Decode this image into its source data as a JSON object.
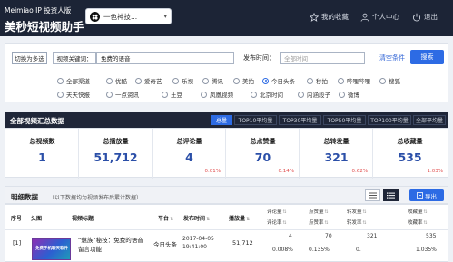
{
  "header": {
    "brand_line1": "Meimiao IP 投资人版",
    "brand_line2": "美秒短视频助手",
    "app_selector": "一色神技...",
    "favorites": "我的收藏",
    "user_center": "个人中心",
    "logout": "退出"
  },
  "filter": {
    "toggle_label": "切换为多选",
    "keyword_label": "视频关键词：",
    "keyword_value": "免费的语音",
    "time_label": "发布时间：",
    "time_placeholder": "全部时间",
    "clear_label": "清空条件",
    "search_label": "搜索",
    "platforms_row1": [
      {
        "label": "全部渠道",
        "selected": false
      },
      {
        "label": "优酷",
        "selected": false
      },
      {
        "label": "爱奇艺",
        "selected": false
      },
      {
        "label": "乐视",
        "selected": false
      },
      {
        "label": "腾讯",
        "selected": false
      },
      {
        "label": "美拍",
        "selected": false
      },
      {
        "label": "今日头条",
        "selected": true
      },
      {
        "label": "秒拍",
        "selected": false
      },
      {
        "label": "哔哩哔哩",
        "selected": false
      },
      {
        "label": "搜狐",
        "selected": false
      }
    ],
    "platforms_row2": [
      {
        "label": "天天快报",
        "selected": false
      },
      {
        "label": "一点资讯",
        "selected": false
      },
      {
        "label": "土豆",
        "selected": false
      },
      {
        "label": "凤凰视频",
        "selected": false
      },
      {
        "label": "北京时间",
        "selected": false
      },
      {
        "label": "内涵段子",
        "selected": false
      },
      {
        "label": "微博",
        "selected": false
      }
    ]
  },
  "summary": {
    "title": "全部视频汇总数据",
    "tabs": [
      {
        "label": "总量",
        "active": true
      },
      {
        "label": "TOP10平均量",
        "active": false
      },
      {
        "label": "TOP30平均量",
        "active": false
      },
      {
        "label": "TOP50平均量",
        "active": false
      },
      {
        "label": "TOP100平均量",
        "active": false
      },
      {
        "label": "全部平均量",
        "active": false
      }
    ],
    "cards": [
      {
        "label": "总视频数",
        "value": "1",
        "pct": ""
      },
      {
        "label": "总播放量",
        "value": "51,712",
        "pct": ""
      },
      {
        "label": "总评论量",
        "value": "4",
        "pct": "0.01%"
      },
      {
        "label": "总点赞量",
        "value": "70",
        "pct": "0.14%"
      },
      {
        "label": "总转发量",
        "value": "321",
        "pct": "0.62%"
      },
      {
        "label": "总收藏量",
        "value": "535",
        "pct": "1.03%"
      }
    ]
  },
  "detail": {
    "title": "明细数据",
    "note": "（以下数据均为视频发布后累计数据）",
    "export_label": "导出",
    "columns": {
      "index": "序号",
      "thumb": "头图",
      "title": "视频标题",
      "platform": "平台",
      "publish_time": "发布时间",
      "plays": "播放量",
      "comments": "评论量",
      "comment_rate": "评论率",
      "likes": "点赞量",
      "like_rate": "点赞率",
      "shares": "转发量",
      "share_rate": "转发率",
      "favorites": "收藏量",
      "favorite_rate": "收藏率"
    },
    "rows": [
      {
        "index": "[1]",
        "thumb_text": "免费手机聊天软件",
        "title_line1": "“魅族”秘技：免费的语音",
        "title_line2": "留言功能！",
        "platform": "今日头条",
        "date": "2017-04-05",
        "time": "19:41:00",
        "plays": "51,712",
        "comments": "4",
        "comment_rate": "0.008%",
        "likes": "70",
        "like_rate": "0.135%",
        "shares": "321",
        "share_rate": "0.",
        "favorites": "535",
        "favorite_rate": "1.035%"
      }
    ]
  }
}
